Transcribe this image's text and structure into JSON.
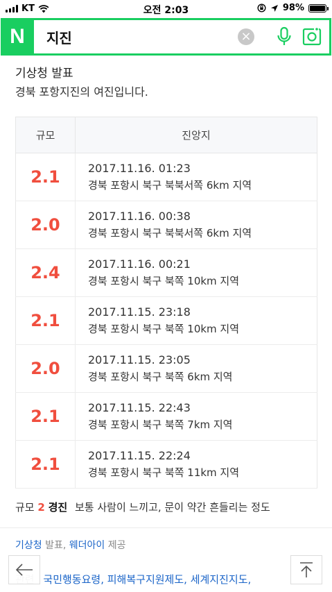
{
  "status_bar": {
    "carrier": "KT",
    "time": "오전 2:03",
    "battery": "98%",
    "battery_level": 0.98
  },
  "search": {
    "logo": "N",
    "query": "지진",
    "icons": [
      "clear-icon",
      "mic-icon",
      "lens-icon"
    ],
    "accent_color": "#19ce60"
  },
  "header": {
    "title": "기상청 발표",
    "subtitle": "경북 포항지진의 여진입니다."
  },
  "table": {
    "columns": [
      "규모",
      "진앙지"
    ],
    "rows": [
      {
        "magnitude": "2.1",
        "time": "2017.11.16. 01:23",
        "location": "경북 포항시 북구 북북서쪽 6km 지역"
      },
      {
        "magnitude": "2.0",
        "time": "2017.11.16. 00:38",
        "location": "경북 포항시 북구 북북서쪽 6km 지역"
      },
      {
        "magnitude": "2.4",
        "time": "2017.11.16. 00:21",
        "location": "경북 포항시 북구 북쪽 10km 지역"
      },
      {
        "magnitude": "2.1",
        "time": "2017.11.15. 23:18",
        "location": "경북 포항시 북구 북쪽 10km 지역"
      },
      {
        "magnitude": "2.0",
        "time": "2017.11.15. 23:05",
        "location": "경북 포항시 북구 북쪽 6km 지역"
      },
      {
        "magnitude": "2.1",
        "time": "2017.11.15. 22:43",
        "location": "경북 포항시 북구 북쪽 7km 지역"
      },
      {
        "magnitude": "2.1",
        "time": "2017.11.15. 22:24",
        "location": "경북 포항시 북구 북쪽 11km 지역"
      }
    ],
    "magnitude_color": "#f04e3e"
  },
  "scale_note": {
    "prefix": "규모",
    "number": "2",
    "level": "경진",
    "description": "보통 사람이 느끼고, 문이 약간 흔들리는 정도"
  },
  "source": {
    "agency": "기상청",
    "agency_suffix": "발표,",
    "provider": "웨더아이",
    "provider_suffix": "제공"
  },
  "related": {
    "label": "관련",
    "links": [
      "국민행동요령,",
      "피해복구지원제도,",
      "세계지진지도,"
    ]
  },
  "nav": {
    "back_icon": "arrow-left-icon",
    "top_icon": "arrow-up-to-top-icon"
  }
}
